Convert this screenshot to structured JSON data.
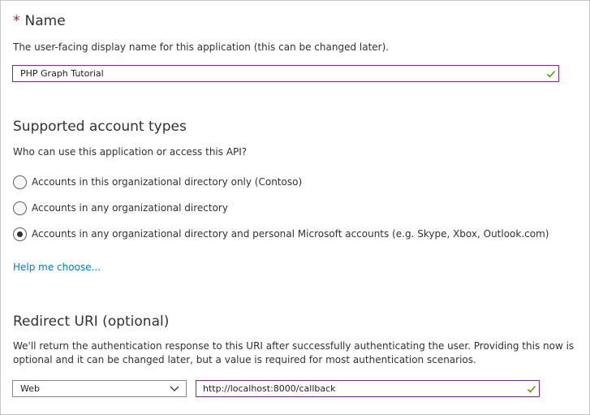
{
  "name_section": {
    "required_marker": "*",
    "title": "Name",
    "description": "The user-facing display name for this application (this can be changed later).",
    "input_value": "PHP Graph Tutorial"
  },
  "account_types": {
    "title": "Supported account types",
    "question": "Who can use this application or access this API?",
    "options": [
      {
        "label": "Accounts in this organizational directory only (Contoso)",
        "selected": false
      },
      {
        "label": "Accounts in any organizational directory",
        "selected": false
      },
      {
        "label": "Accounts in any organizational directory and personal Microsoft accounts (e.g. Skype, Xbox, Outlook.com)",
        "selected": true
      }
    ],
    "help_link": "Help me choose..."
  },
  "redirect": {
    "title": "Redirect URI (optional)",
    "description_line1": "We'll return the authentication response to this URI after successfully authenticating the user. Providing this now is",
    "description_line2": "optional and it can be changed later, but a value is required for most authentication scenarios.",
    "platform_value": "Web",
    "uri_value": "http://localhost:8000/callback"
  },
  "colors": {
    "text": "#323130",
    "link": "#0078d4",
    "required": "#a4262c",
    "focus_border": "#7b2d8f",
    "valid_check": "#57a300"
  },
  "icons": {
    "valid": "checkmark-icon",
    "dropdown": "chevron-down-icon"
  }
}
